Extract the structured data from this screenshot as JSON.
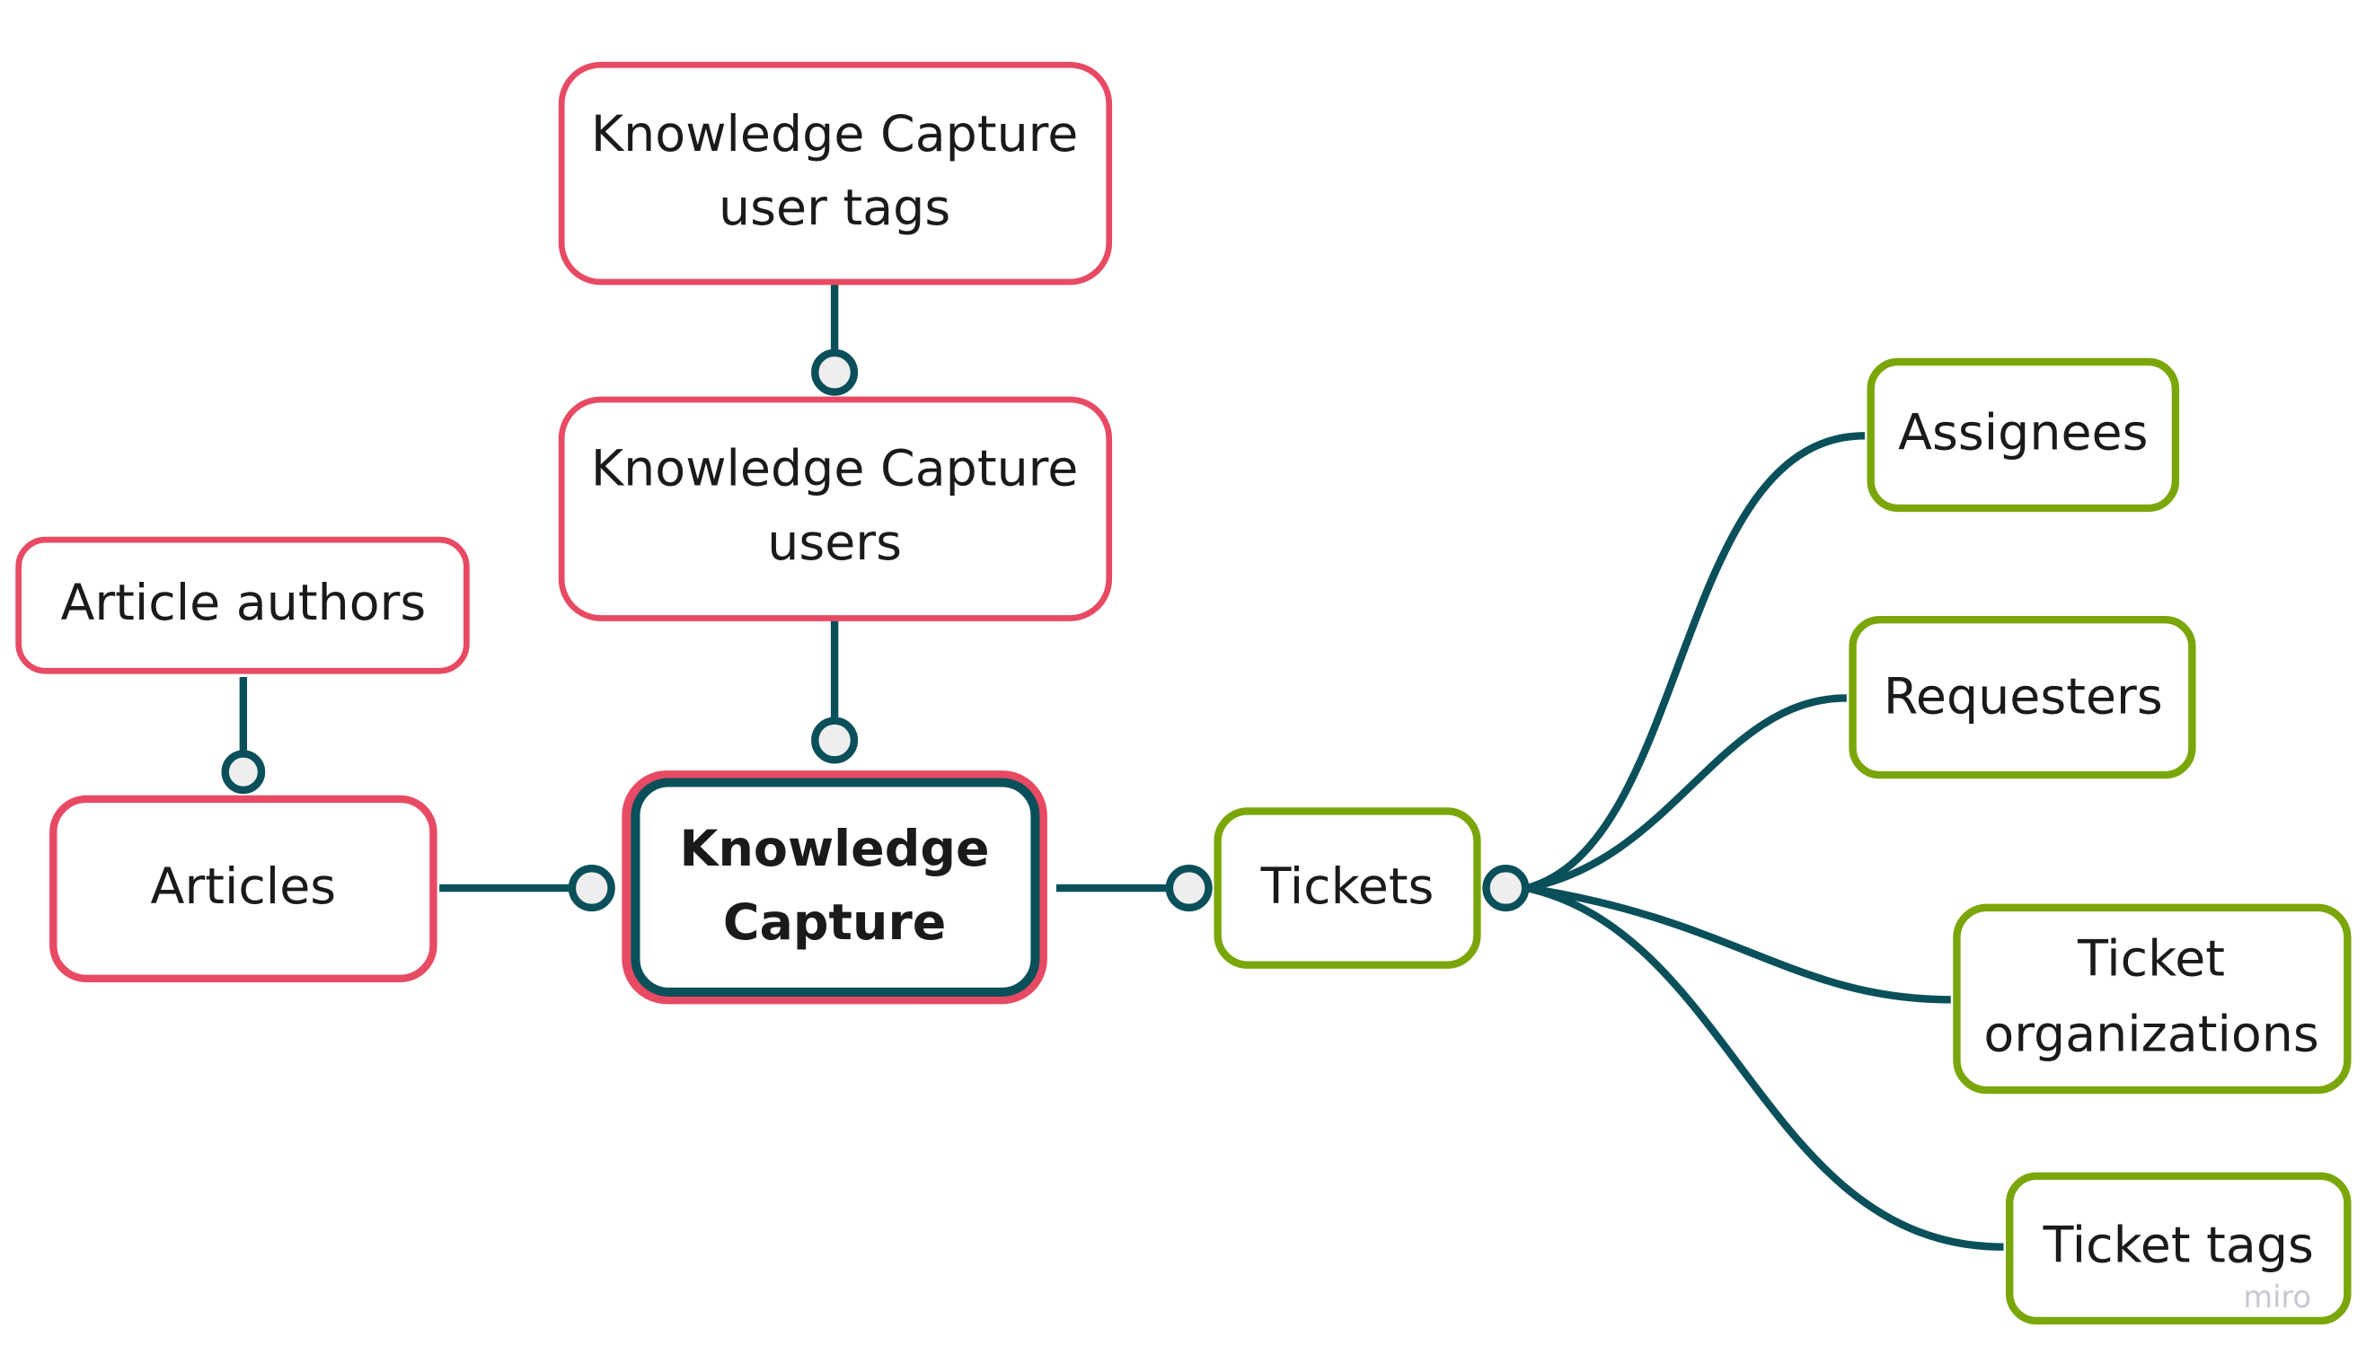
{
  "colors": {
    "pink": "#e84a64",
    "green": "#7ba60a",
    "teal": "#0a505a",
    "dot_fill": "#eeeeee"
  },
  "nodes": {
    "central": {
      "lines": [
        "Knowledge",
        "Capture"
      ]
    },
    "kc_user_tags": {
      "lines": [
        "Knowledge Capture",
        "user tags"
      ]
    },
    "kc_users": {
      "lines": [
        "Knowledge Capture",
        "users"
      ]
    },
    "article_authors": {
      "lines": [
        "Article authors"
      ]
    },
    "articles": {
      "lines": [
        "Articles"
      ]
    },
    "tickets": {
      "lines": [
        "Tickets"
      ]
    },
    "assignees": {
      "lines": [
        "Assignees"
      ]
    },
    "requesters": {
      "lines": [
        "Requesters"
      ]
    },
    "ticket_organizations": {
      "lines": [
        "Ticket",
        "organizations"
      ]
    },
    "ticket_tags": {
      "lines": [
        "Ticket tags"
      ]
    }
  },
  "watermark": "miro"
}
